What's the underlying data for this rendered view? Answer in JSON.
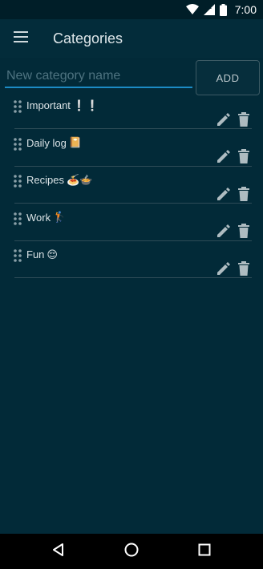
{
  "status_bar": {
    "time": "7:00",
    "icons": [
      "wifi-icon",
      "lte-signal-icon",
      "battery-icon"
    ]
  },
  "app_bar": {
    "menu_icon": "menu-icon",
    "title": "Categories"
  },
  "add_form": {
    "placeholder": "New category name",
    "value": "",
    "button_label": "ADD"
  },
  "categories": [
    {
      "label": "Important",
      "emoji": "❕❕"
    },
    {
      "label": "Daily log",
      "emoji": "📔"
    },
    {
      "label": "Recipes",
      "emoji": "🍝🍲"
    },
    {
      "label": "Work",
      "emoji": "🏌"
    },
    {
      "label": "Fun",
      "emoji": "😌"
    }
  ],
  "colors": {
    "background": "#022a38",
    "accent": "#1c8bc4",
    "divider": "#2e4c57"
  }
}
